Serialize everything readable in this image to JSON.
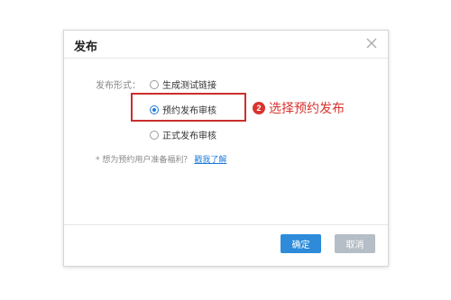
{
  "dialog": {
    "title": "发布",
    "form_label": "发布形式：",
    "options": [
      {
        "label": "生成测试链接",
        "checked": false
      },
      {
        "label": "预约发布审核",
        "checked": true
      },
      {
        "label": "正式发布审核",
        "checked": false
      }
    ],
    "hint": {
      "text": "* 想为预约用户准备福利？",
      "link": "戳我了解"
    },
    "footer": {
      "confirm_label": "确定",
      "cancel_label": "取消"
    }
  },
  "annotation": {
    "step_number": "2",
    "step_text": "选择预约发布",
    "color": "#d9342f"
  },
  "colors": {
    "primary": "#2d8bd9",
    "disabled": "#b5bdc6",
    "highlight_border": "#c9302c"
  }
}
